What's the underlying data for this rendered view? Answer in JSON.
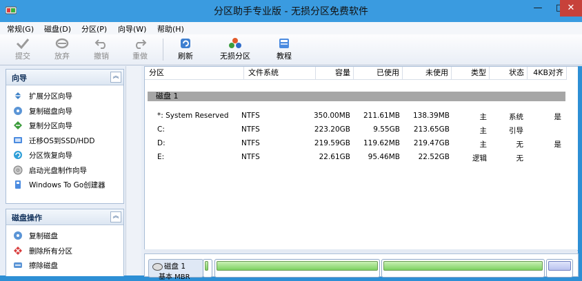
{
  "window": {
    "title": "分区助手专业版 - 无损分区免费软件",
    "minimize": "—",
    "maximize": "□",
    "close": "✕"
  },
  "menu": [
    "常规(G)",
    "磁盘(D)",
    "分区(P)",
    "向导(W)",
    "帮助(H)"
  ],
  "toolbar": {
    "items": [
      {
        "label": "提交",
        "icon": "check-icon",
        "enabled": false
      },
      {
        "label": "放弃",
        "icon": "discard-icon",
        "enabled": false
      },
      {
        "label": "撤销",
        "icon": "undo-icon",
        "enabled": false
      },
      {
        "label": "重做",
        "icon": "redo-icon",
        "enabled": false
      },
      {
        "label": "刷新",
        "icon": "refresh-icon",
        "enabled": true
      },
      {
        "label": "无损分区",
        "icon": "partition-icon",
        "enabled": true
      },
      {
        "label": "教程",
        "icon": "book-icon",
        "enabled": true
      }
    ]
  },
  "wizard_panel": {
    "title": "向导",
    "collapse": "︽",
    "items": [
      "扩展分区向导",
      "复制磁盘向导",
      "复制分区向导",
      "迁移OS到SSD/HDD",
      "分区恢复向导",
      "启动光盘制作向导",
      "Windows To Go创建器"
    ]
  },
  "disk_panel": {
    "title": "磁盘操作",
    "collapse": "︽",
    "items": [
      "复制磁盘",
      "删除所有分区",
      "擦除磁盘"
    ]
  },
  "table": {
    "headers": [
      "分区",
      "文件系统",
      "容量",
      "已使用",
      "未使用",
      "类型",
      "状态",
      "4KB对齐"
    ],
    "disk_label": "磁盘 1",
    "rows": [
      [
        "*: System Reserved",
        "NTFS",
        "350.00MB",
        "211.61MB",
        "138.39MB",
        "主",
        "系统",
        "是"
      ],
      [
        "C:",
        "NTFS",
        "223.20GB",
        "9.55GB",
        "213.65GB",
        "主",
        "引导",
        ""
      ],
      [
        "D:",
        "NTFS",
        "219.59GB",
        "119.62MB",
        "219.47GB",
        "主",
        "无",
        "是"
      ],
      [
        "E:",
        "NTFS",
        "22.61GB",
        "95.46MB",
        "22.52GB",
        "逻辑",
        "无",
        ""
      ]
    ]
  },
  "disk_map": {
    "disk_name": "磁盘 1",
    "sub_label": "基本 MBR"
  },
  "colors": {
    "title_bg": "#3a9be0",
    "partition_green": "#7dd160",
    "partition_blue": "#b9c2ee",
    "disk_row_gray": "#a6a6a6"
  }
}
